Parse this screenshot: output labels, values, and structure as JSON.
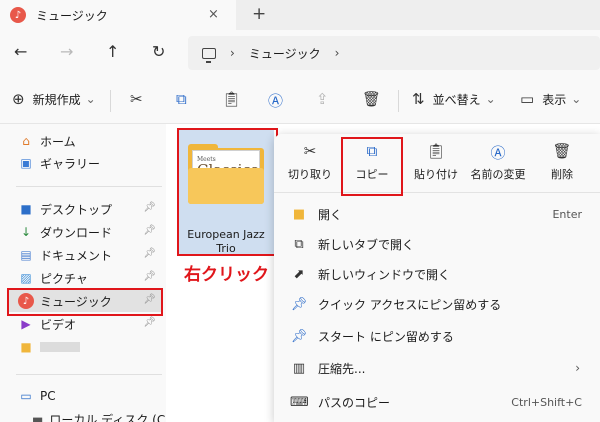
{
  "tab": {
    "title": "ミュージック",
    "close": "×",
    "new_tab": "+",
    "app_icon": "♪"
  },
  "nav": {
    "back": "←",
    "forward": "→",
    "up": "↑",
    "refresh": "↻"
  },
  "address": {
    "sep1": "›",
    "location": "ミュージック",
    "sep2": "›"
  },
  "toolbar": {
    "new_label": "新規作成",
    "new_chevron": "⌄",
    "sort_label": "並べ替え",
    "sort_chevron": "⌄",
    "view_label": "表示",
    "view_chevron": "⌄"
  },
  "sidebar": {
    "home": "ホーム",
    "gallery": "ギャラリー",
    "desktop": "デスクトップ",
    "downloads": "ダウンロード",
    "documents": "ドキュメント",
    "pictures": "ピクチャ",
    "music": "ミュージック",
    "videos": "ビデオ",
    "pc": "PC",
    "local_disk": "ローカル ディスク (C:)"
  },
  "folder": {
    "name": "European Jazz Trio",
    "cover_small": "Meets",
    "cover_big": "Classics"
  },
  "annotation": {
    "right_click": "右クリック"
  },
  "context_menu": {
    "quick_actions": {
      "cut": "切り取り",
      "copy": "コピー",
      "paste": "貼り付け",
      "rename": "名前の変更",
      "delete": "削除"
    },
    "items": {
      "open": "開く",
      "open_shortcut": "Enter",
      "open_new_tab": "新しいタブで開く",
      "open_new_window": "新しいウィンドウで開く",
      "pin_quick_access": "クイック アクセスにピン留めする",
      "pin_start": "スタート にピン留めする",
      "compress": "圧縮先...",
      "copy_path": "パスのコピー",
      "copy_path_shortcut": "Ctrl+Shift+C"
    }
  },
  "colors": {
    "highlight": "#e0161b",
    "accent": "#2768c8",
    "folder": "#f0b63b"
  }
}
